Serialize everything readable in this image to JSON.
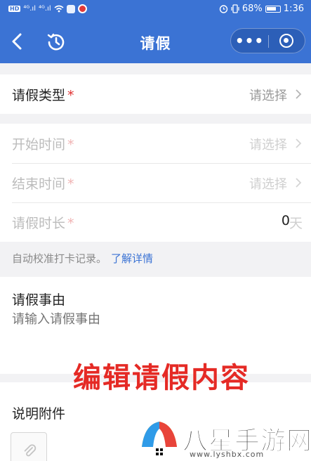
{
  "status_bar": {
    "left_chip": "HD",
    "signal_1": "⁴ᴳ.ıl",
    "signal_2": "⁴ᴳ.ıl",
    "battery_percent": "68%",
    "time": "1:36"
  },
  "nav": {
    "title": "请假",
    "more_glyph": "•••"
  },
  "form": {
    "leave_type": {
      "label": "请假类型",
      "required_mark": "*",
      "value": "请选择"
    },
    "start_time": {
      "label": "开始时间",
      "required_mark": "*",
      "value": "请选择"
    },
    "end_time": {
      "label": "结束时间",
      "required_mark": "*",
      "value": "请选择"
    },
    "duration": {
      "label": "请假时长",
      "required_mark": "*",
      "value": "0",
      "unit": "天"
    },
    "hint": {
      "text": "自动校准打卡记录。",
      "link": "了解详情"
    },
    "reason": {
      "label": "请假事由",
      "placeholder": "请输入请假事由"
    },
    "attachment": {
      "label": "说明附件"
    }
  },
  "overlay_caption": "编辑请假内容",
  "watermark": {
    "brand": "八星手游网",
    "url": "www.lyshbx.com"
  },
  "colors": {
    "primary": "#3b73d4",
    "required": "#e03030",
    "caption": "#e52a25"
  }
}
